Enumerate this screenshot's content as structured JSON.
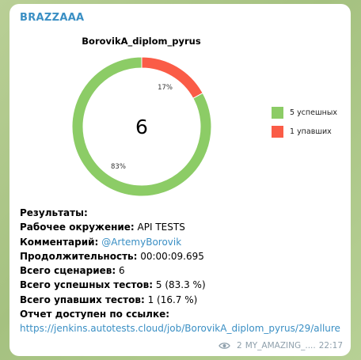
{
  "message": {
    "sender": "BRAZZAAA",
    "views_icon": "eye-icon",
    "views": "2",
    "channel": "MY_AMAZING_....",
    "time": "22:17"
  },
  "chart_data": {
    "type": "pie",
    "title": "BorovikA_diplom_pyrus",
    "center_label": "6",
    "slices": [
      {
        "name": "5 успешных",
        "value": 83,
        "label": "83%",
        "color": "#8ccc66"
      },
      {
        "name": "1 упавших",
        "value": 17,
        "label": "17%",
        "color": "#fa5c47"
      }
    ],
    "legend_position": "right"
  },
  "report": {
    "heading": "Результаты:",
    "env_label": "Рабочее окружение:",
    "env_value": " API TESTS",
    "comment_label": "Комментарий:",
    "comment_value": "@ArtemyBorovik",
    "duration_label": "Продолжительность:",
    "duration_value": " 00:00:09.695",
    "scenarios_label": "Всего сценариев:",
    "scenarios_value": " 6",
    "passed_label": "Всего успешных тестов:",
    "passed_value": " 5 (83.3 %)",
    "failed_label": "Всего упавших тестов:",
    "failed_value": " 1 (16.7 %)",
    "link_label": "Отчет доступен по ссылке:",
    "link_url": "https://jenkins.autotests.cloud/job/BorovikA_diplom_pyrus/29/allure"
  }
}
